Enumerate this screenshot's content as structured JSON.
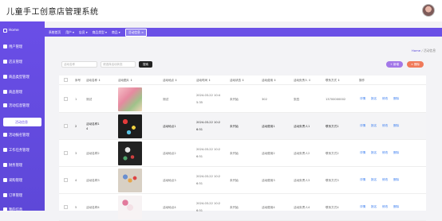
{
  "header": {
    "title": "儿童手工创意店管理系统"
  },
  "sidebar": {
    "items": [
      {
        "label": "Home"
      },
      {
        "label": "用户管理"
      },
      {
        "label": "店员管理"
      },
      {
        "label": "商品类型管理"
      },
      {
        "label": "商品管理"
      },
      {
        "label": "活动信息管理"
      },
      {
        "label": "活动报名管理"
      },
      {
        "label": "工作任务管理"
      },
      {
        "label": "财务管理"
      },
      {
        "label": "采购管理"
      },
      {
        "label": "订单管理"
      },
      {
        "label": "我的信息"
      }
    ],
    "sub_active": "活动信息"
  },
  "navbar": {
    "items": [
      {
        "label": "系统首页"
      },
      {
        "label": "用户 ▾"
      },
      {
        "label": "店员 ▾"
      },
      {
        "label": "商品类型 ▾"
      },
      {
        "label": "商品 ▾"
      },
      {
        "label": "活动信息 ×"
      }
    ]
  },
  "breadcrumb": {
    "home": "Home",
    "current": "活动信息"
  },
  "search": {
    "placeholder1": "活动名称",
    "placeholder2": "请选择活动状态",
    "button": "搜索",
    "add": "+ 新增",
    "delete": "× 删除"
  },
  "table": {
    "columns": [
      "序号",
      "活动名称 ⇕",
      "活动图片 ⇕",
      "活动地点 ⇕",
      "活动时间 ⇕",
      "活动状态 ⇕",
      "活动费用 ⇕",
      "活动负责人 ⇕",
      "联系方式 ⇕",
      "操作"
    ],
    "rows": [
      {
        "no": "1",
        "name": "测试",
        "location": "测试",
        "time1": "2024-03-22 10:4",
        "time2": "5:35",
        "status": "未开始",
        "fee": "302",
        "owner": "张四",
        "contact": "13700000002"
      },
      {
        "no": "2",
        "name": "活动名称1",
        "name2": "4",
        "location": "活动地点1",
        "time1": "2024-03-22 10:2",
        "time2": "6:51",
        "status": "未开始",
        "fee": "活动费用1",
        "owner": "活动负责人1",
        "contact": "联系方式1"
      },
      {
        "no": "3",
        "name": "活动名称2",
        "location": "活动地点2",
        "time1": "2024-03-22 10:2",
        "time2": "6:51",
        "status": "未开始",
        "fee": "活动费用2",
        "owner": "活动负责人2",
        "contact": "联系方式2"
      },
      {
        "no": "4",
        "name": "活动名称3",
        "location": "活动地点3",
        "time1": "2024-03-22 10:2",
        "time2": "6:51",
        "status": "未开始",
        "fee": "活动费用3",
        "owner": "活动负责人3",
        "contact": "联系方式3"
      },
      {
        "no": "5",
        "name": "活动名称4",
        "location": "活动地点4",
        "time1": "2024-03-22 10:2",
        "time2": "6:51",
        "status": "未开始",
        "fee": "活动费用4",
        "owner": "活动负责人4",
        "contact": "联系方式4"
      }
    ],
    "actions": [
      "详情",
      "报名",
      "修改",
      "删除"
    ]
  },
  "colors": {
    "accent": "#6a4ee7",
    "link": "#3d7ff0",
    "add": "#a378e8",
    "delete": "#f07a5a"
  }
}
